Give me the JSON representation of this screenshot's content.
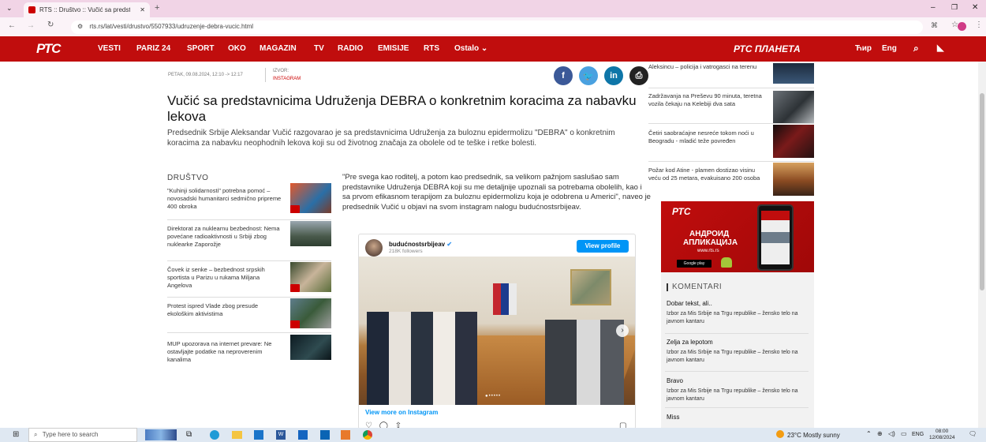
{
  "browser": {
    "tab_title": "RTS :: Društvo :: Vučić sa predst",
    "url": "rts.rs/lat/vesti/drustvo/5507933/udruzenje-debra-vucic.html"
  },
  "nav": {
    "logo": "РТС",
    "items": [
      "VESTI",
      "PARIZ 24",
      "SPORT",
      "OKO",
      "MAGAZIN",
      "TV",
      "RADIO",
      "EMISIJE",
      "RTS",
      "Ostalo"
    ],
    "planeta": "РТС ПЛАНЕТА",
    "cyr": "Ћир",
    "eng": "Eng"
  },
  "article": {
    "date": "PETAK, 09.08.2024, 12:10 -> 12:17",
    "source_label": "IZVOR:",
    "source": "INSTAGRAM",
    "title": "Vučić sa predstavnicima Udruženja DEBRA o konkretnim koracima za nabavku lekova",
    "lead": "Predsednik Srbije Aleksandar Vučić razgovarao je sa predstavnicima Udruženja za buloznu epidermolizu \"DEBRA\" o konkretnim koracima za nabavku neophodnih lekova koji su od životnog značaja za obolele od te teške i retke bolesti.",
    "body": "\"Pre svega kao roditelj, a potom kao predsednik, sa velikom pažnjom saslušao sam predstavnike Udruženja DEBRA koji su me detaljnije upoznali sa potrebama obolelih, kao i sa prvom efikasnom terapijom za buloznu epidermolizu koja je odobrena u Americi\", naveo je predsednik Vučić u objavi na svom instagram nalogu budućnostsrbijeav."
  },
  "social": [
    "f",
    "t",
    "in",
    "print"
  ],
  "sidebar": {
    "heading": "DRUŠTVO",
    "items": [
      "\"Kuhinji solidarnosti\" potrebna pomoć – novosadski humanitarci sedmično pripreme 400 obroka",
      "Direktorat za nuklearnu bezbednost: Nema povećane radioaktivnosti u Srbiji zbog nuklearke Zaporožje",
      "Čovek iz senke – bezbednost srpskih sportista u Parizu u rukama Miljana Angelova",
      "Protest ispred Vlade zbog presude ekološkim aktivistima",
      "MUP upozorava na internet prevare: Ne ostavljajte podatke na neproverenim kanalima"
    ]
  },
  "instagram": {
    "account": "budućnostsrbijeav",
    "followers": "218K followers",
    "view_profile": "View profile",
    "view_more": "View more on Instagram"
  },
  "right": {
    "items": [
      "Aleksincu – policija i vatrogasci na terenu",
      "Zadržavanja na Preševu 90 minuta, teretna vozila čekaju na Kelebiji dva sata",
      "Četiri saobraćajne nesreće tokom noći u Beogradu - mladić teže povređen",
      "Požar kod Atine - plamen dostizao visinu veću od 25 metara, evakuisano 200 osoba"
    ],
    "ad": {
      "logo": "РТС",
      "line1": "АНДРОИД",
      "line2": "АПЛИКАЦИЈА",
      "site": "www.rts.rs",
      "store": "Google play"
    },
    "komentari_heading": "KOMENTARI",
    "komentari": [
      {
        "title": "Dobar tekst, ali..",
        "sub": "Izbor za Mis Srbije na Trgu republike – žensko telo na javnom kantaru"
      },
      {
        "title": "Zelja za lepotom",
        "sub": "Izbor za Mis Srbije na Trgu republike – žensko telo na javnom kantaru"
      },
      {
        "title": "Bravo",
        "sub": "Izbor za Mis Srbije na Trgu republike – žensko telo na javnom kantaru"
      },
      {
        "title": "Miss",
        "sub": ""
      }
    ]
  },
  "taskbar": {
    "search_placeholder": "Type here to search",
    "weather": "23°C  Mostly sunny",
    "lang": "ENG",
    "time": "08:00",
    "date": "12/08/2024"
  }
}
